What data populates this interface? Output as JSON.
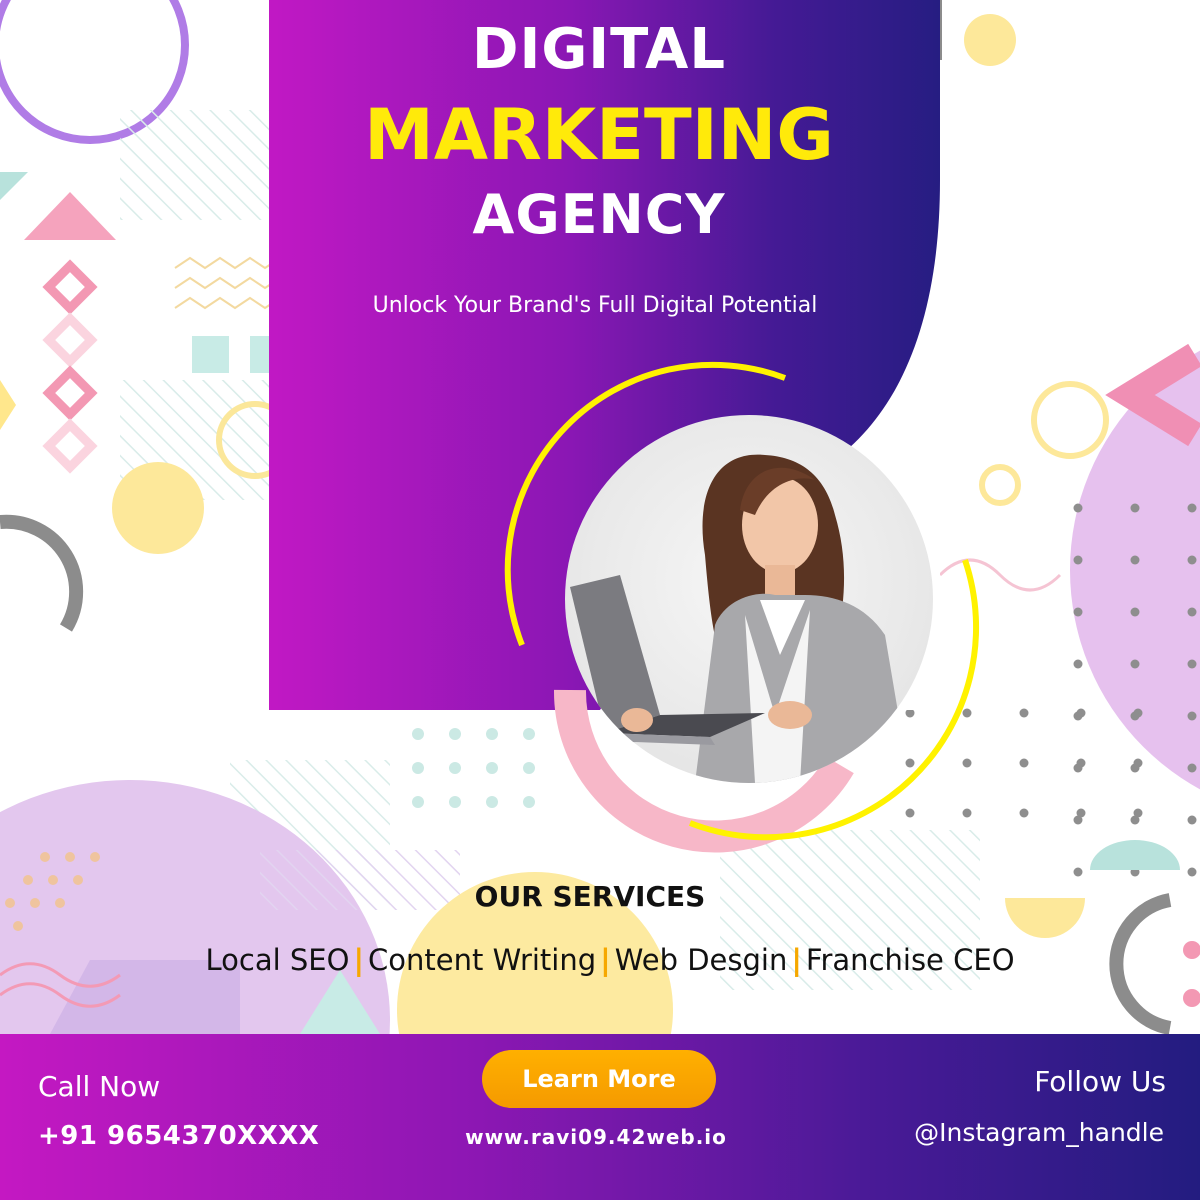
{
  "headline": {
    "line1": "DIGITAL",
    "line2": "MARKETING",
    "line3": "AGENCY"
  },
  "tagline": "Unlock Your Brand's Full Digital Potential",
  "services": {
    "title": "OUR SERVICES",
    "items": [
      "Local SEO",
      "Content Writing",
      "Web Desgin",
      "Franchise CEO"
    ],
    "separator": "|"
  },
  "footer": {
    "call_label": "Call Now",
    "phone": "+91 9654370XXXX",
    "cta_label": "Learn More",
    "website": "www.ravi09.42web.io",
    "follow_label": "Follow Us",
    "handle": "@Instagram_handle"
  },
  "colors": {
    "headline_accent": "#ffea0a",
    "gradient_start": "#c118c4",
    "gradient_end": "#261d82",
    "cta": "#ffb000",
    "separator": "#f6a800"
  },
  "icons": [
    "woman-with-laptop-photo"
  ]
}
